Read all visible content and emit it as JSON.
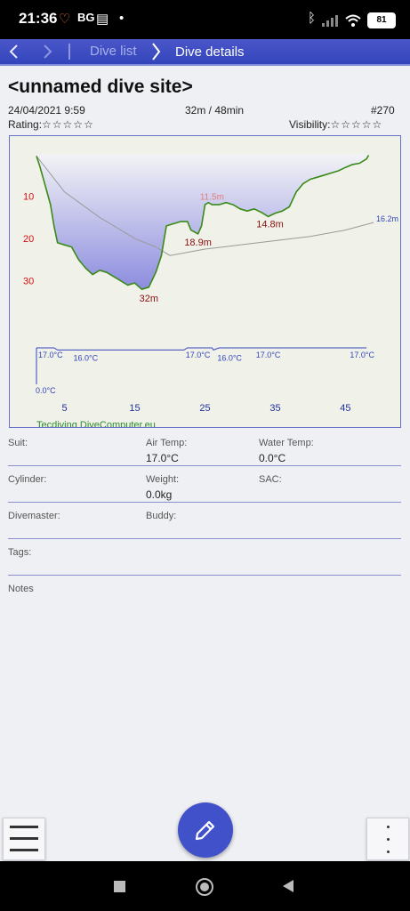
{
  "status_bar": {
    "time": "21:36",
    "carrier_badge": "BG",
    "dot": "•",
    "battery": "81"
  },
  "toolbar": {
    "back_icon": "chevron-left-icon",
    "forward_icon": "chevron-right-icon",
    "breadcrumb_parent": "Dive list",
    "breadcrumb_current": "Dive details",
    "accent_color": "#3f4fc4"
  },
  "dive": {
    "site_name": "<unnamed dive site>",
    "datetime": "24/04/2021 9:59",
    "depth_duration": "32m / 48min",
    "number": "#270",
    "rating_label": "Rating:",
    "rating_stars": "☆☆☆☆☆",
    "visibility_label": "Visibility:",
    "visibility_stars": "☆☆☆☆☆"
  },
  "chart_data": {
    "type": "area",
    "title": "",
    "xlabel": "",
    "ylabel": "",
    "x_ticks": [
      "5",
      "15",
      "25",
      "35",
      "45"
    ],
    "y_ticks": [
      "10",
      "20",
      "30"
    ],
    "xlim": [
      1,
      49
    ],
    "ylim": [
      0,
      37
    ],
    "depth_profile": {
      "x": [
        1,
        1.5,
        2,
        3,
        3.5,
        4,
        5,
        6,
        7,
        8,
        9,
        10,
        11,
        12,
        13,
        14,
        15,
        16,
        17,
        18,
        18.8,
        19.5,
        20.5,
        21.5,
        22.5,
        23,
        24,
        24.5,
        25,
        25.5,
        26,
        27,
        28,
        29,
        30,
        31,
        32,
        33,
        34,
        35,
        36,
        37,
        38,
        39,
        40,
        41,
        42,
        43,
        44,
        45,
        46,
        47,
        48,
        48.3
      ],
      "y": [
        0.5,
        3,
        6,
        12,
        17,
        21,
        21.5,
        22,
        25,
        27,
        28.5,
        27.5,
        28,
        29,
        30,
        31,
        30.5,
        32,
        31.5,
        28,
        24,
        17,
        16.5,
        16,
        16,
        18,
        18.9,
        17,
        12,
        11.5,
        12,
        12,
        11.5,
        12,
        13,
        13.5,
        13,
        13.8,
        14.8,
        14,
        13.5,
        12.5,
        9,
        7,
        6,
        5.5,
        5,
        4.5,
        4,
        3.2,
        2.5,
        2.2,
        1.2,
        0.3
      ]
    },
    "ndl_line": {
      "x": [
        1,
        5,
        10,
        15,
        18,
        20,
        25,
        30,
        35,
        40,
        45,
        49
      ],
      "y": [
        0.5,
        9,
        15,
        20,
        22,
        24,
        22.5,
        21.5,
        20.5,
        19.5,
        18,
        16.2
      ]
    },
    "depth_labels": [
      {
        "x": 17,
        "y": 32,
        "text": "32m"
      },
      {
        "x": 24,
        "y": 18.9,
        "text": "18.9m"
      },
      {
        "x": 26,
        "y": 11.5,
        "text": "11.5m"
      },
      {
        "x": 34,
        "y": 14.8,
        "text": "14.8m"
      },
      {
        "x": 49,
        "y": 16.2,
        "text": "16.2m"
      }
    ],
    "temperature": {
      "x": [
        1,
        3.5,
        4,
        22,
        22.5,
        26,
        26.2,
        27,
        48
      ],
      "y": [
        17.0,
        17.0,
        16.0,
        16.0,
        17.0,
        17.0,
        16.0,
        17.0,
        17.0
      ],
      "labels": [
        {
          "x": 3,
          "text": "17.0°C"
        },
        {
          "x": 8,
          "text": "16.0°C"
        },
        {
          "x": 24,
          "text": "17.0°C"
        },
        {
          "x": 28.5,
          "text": "16.0°C"
        },
        {
          "x": 34,
          "text": "17.0°C"
        },
        {
          "x": 48,
          "text": "17.0°C"
        }
      ],
      "zero_label": "0.0°C"
    },
    "computer": "Tecdiving DiveComputer.eu",
    "colors": {
      "depth_fill_top": "#f3f3f6",
      "depth_fill_bottom": "#8c8cdf",
      "profile_line": "#3a8a18",
      "axis_labels": "#d01010",
      "x_tick_labels": "#2030a0",
      "temperature": "#3344bb",
      "ndl_line": "#9a9a9a",
      "depth_label": "#8a0f0f",
      "computer_label": "#2a8a2a"
    }
  },
  "details": {
    "suit_label": "Suit:",
    "suit_value": "",
    "air_temp_label": "Air Temp:",
    "air_temp_value": "17.0°C",
    "water_temp_label": "Water Temp:",
    "water_temp_value": "0.0°C",
    "cylinder_label": "Cylinder:",
    "weight_label": "Weight:",
    "weight_value": "0.0kg",
    "sac_label": "SAC:",
    "divemaster_label": "Divemaster:",
    "buddy_label": "Buddy:",
    "tags_label": "Tags:",
    "notes_label": "Notes"
  },
  "actions": {
    "edit_icon": "pencil-icon",
    "menu_icon": "hamburger-menu-icon",
    "more_icon": "more-vertical-icon"
  }
}
